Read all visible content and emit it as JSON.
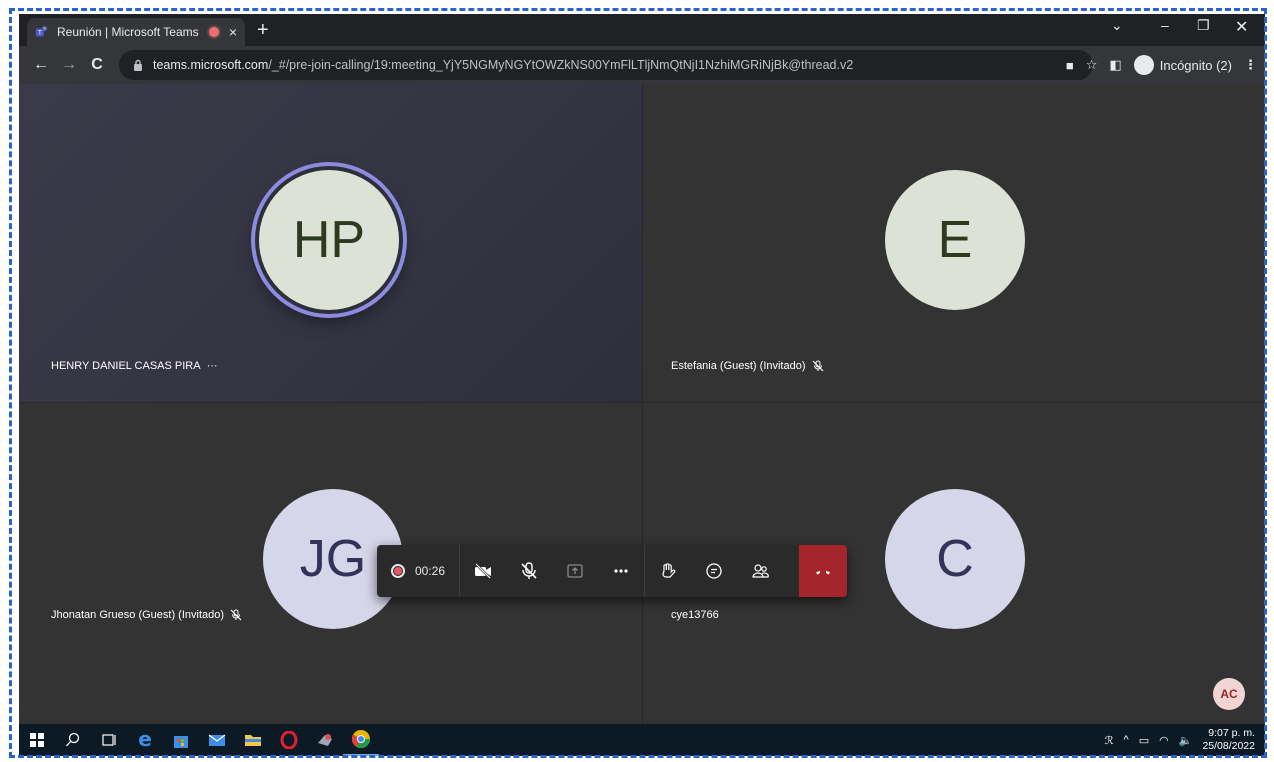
{
  "browser": {
    "tab_title": "Reunión | Microsoft Teams",
    "tab_close": "×",
    "new_tab": "+",
    "url_host": "teams.microsoft.com",
    "url_path": "/_#/pre-join-calling/19:meeting_YjY5NGMyNGYtOWZkNS00YmFlLTljNmQtNjI1NzhiMGRiNjBk@thread.v2",
    "incognito_label": "Incógnito (2)"
  },
  "meeting": {
    "participants": [
      {
        "initials": "HP",
        "name": "HENRY DANIEL CASAS PIRA",
        "extra": "···"
      },
      {
        "initials": "E",
        "name": "Estefania (Guest) (Invitado)"
      },
      {
        "initials": "JG",
        "name": "Jhonatan Grueso (Guest) (Invitado)"
      },
      {
        "initials": "C",
        "name": "cye13766"
      }
    ],
    "timer": "00:26",
    "self_initials": "AC"
  },
  "taskbar": {
    "time": "9:07 p. m.",
    "date": "25/08/2022"
  },
  "colors": {
    "hangup": "#a4262c",
    "speaking_ring": "#8b8be0",
    "avatar_green": "#dce2d6",
    "avatar_purple": "#d6d6ea"
  }
}
